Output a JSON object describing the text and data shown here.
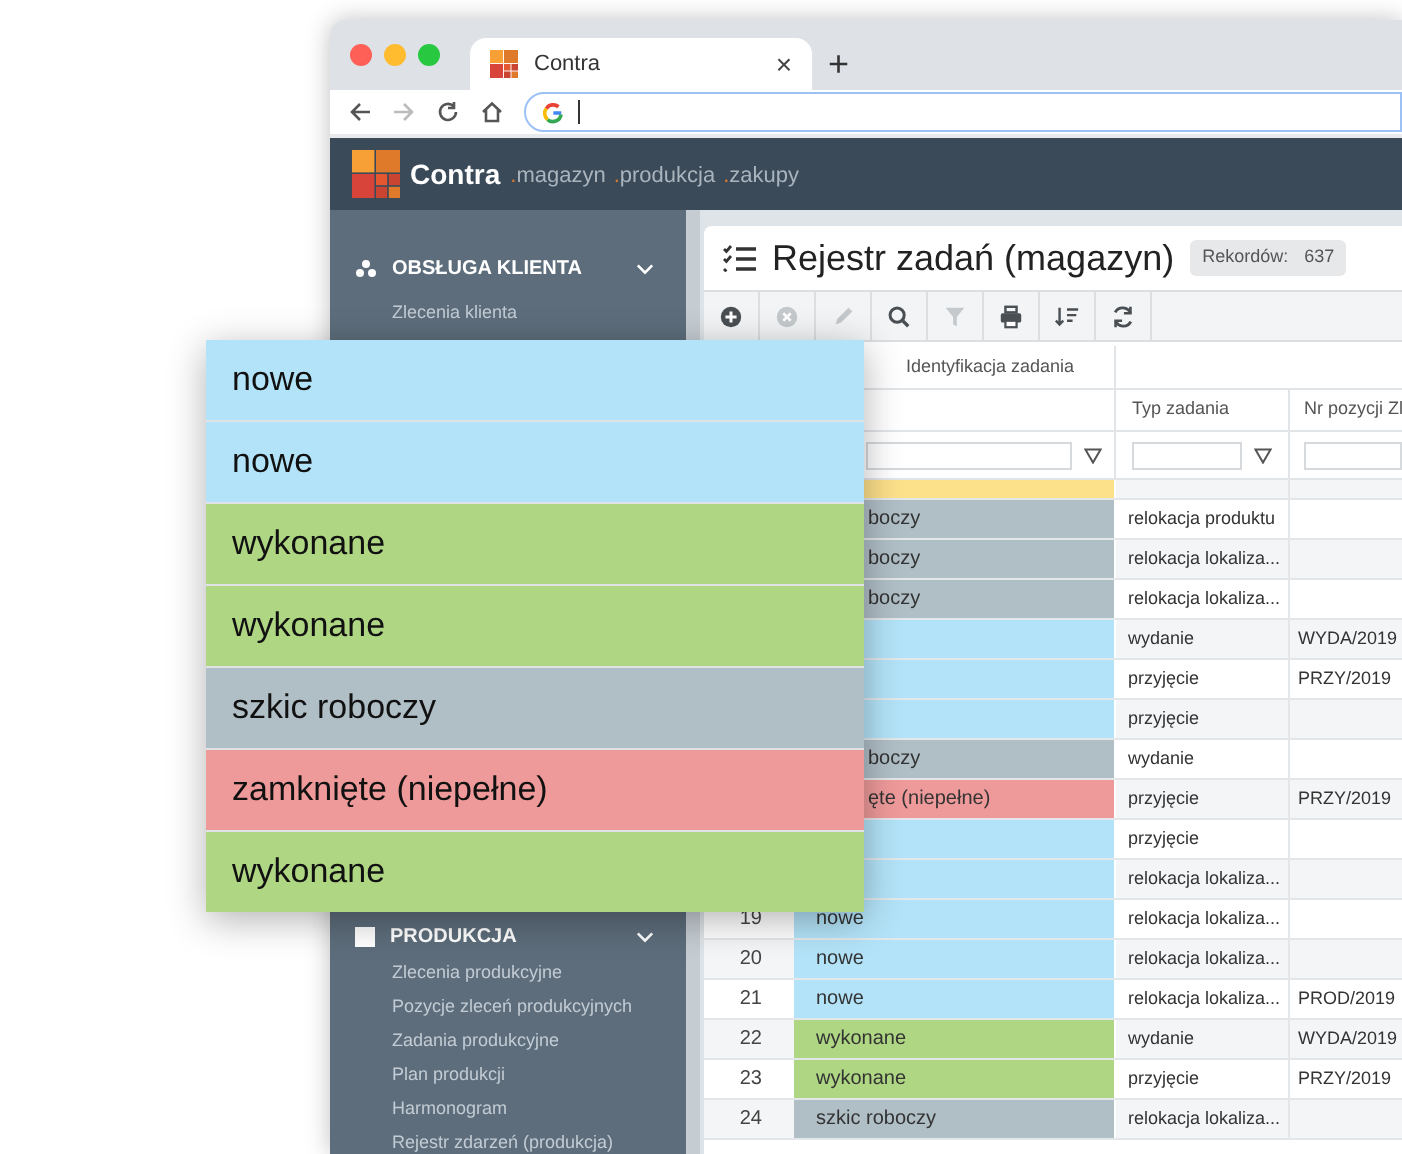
{
  "browser": {
    "tab_title": "Contra",
    "tab_close": "×",
    "new_tab": "+"
  },
  "app_header": {
    "brand": "Contra",
    "modules": [
      ".magazyn",
      ".produkcja",
      ".zakupy"
    ]
  },
  "sidebar": {
    "sections": [
      {
        "kind": "customers",
        "title": "OBSŁUGA KLIENTA",
        "expanded": true,
        "items": [
          "Zlecenia klienta"
        ]
      },
      {
        "kind": "production",
        "title": "PRODUKCJA",
        "expanded": true,
        "items": [
          "Zlecenia produkcyjne",
          "Pozycje zleceń produkcyjnych",
          "Zadania produkcyjne",
          "Plan produkcji",
          "Harmonogram",
          "Rejestr zdarzeń (produkcja)"
        ]
      }
    ]
  },
  "page": {
    "title": "Rejestr zadań (magazyn)",
    "records_label": "Rekordów:",
    "records_count": "637"
  },
  "toolbar": [
    {
      "kind": "add",
      "disabled": false
    },
    {
      "kind": "cancel",
      "disabled": true
    },
    {
      "kind": "edit",
      "disabled": true
    },
    {
      "kind": "search",
      "disabled": false
    },
    {
      "kind": "filter",
      "disabled": true
    },
    {
      "kind": "print",
      "disabled": false
    },
    {
      "kind": "sort",
      "disabled": false
    },
    {
      "kind": "refresh",
      "disabled": false
    }
  ],
  "table": {
    "group_headers": [
      "Identyfikacja zadania"
    ],
    "columns": [
      "Typ zadania",
      "Nr pozycji Zl"
    ],
    "rows": [
      {
        "color": "#fde08a"
      },
      {
        "color": "#b0bec6",
        "status": "boczy",
        "type": "relokacja produktu"
      },
      {
        "color": "#b0bec6",
        "status": "boczy",
        "type": "relokacja lokaliza..."
      },
      {
        "color": "#b0bec6",
        "status": "boczy",
        "type": "relokacja lokaliza..."
      },
      {
        "color": "#b3e3f8",
        "type": "wydanie",
        "order": "WYDA/2019"
      },
      {
        "color": "#b3e3f8",
        "type": "przyjęcie",
        "order": "PRZY/2019"
      },
      {
        "color": "#b3e3f8",
        "type": "przyjęcie"
      },
      {
        "color": "#b0bec6",
        "status": "boczy",
        "type": "wydanie"
      },
      {
        "color": "#ef9a9a",
        "status": "ęte (niepełne)",
        "type": "przyjęcie",
        "order": "PRZY/2019"
      },
      {
        "color": "#b3e3f8",
        "type": "przyjęcie"
      },
      {
        "color": "#b3e3f8",
        "type": "relokacja lokaliza..."
      },
      {
        "number": "19",
        "color": "#b3e3f8",
        "status": "nowe",
        "type": "relokacja lokaliza..."
      },
      {
        "number": "20",
        "color": "#b3e3f8",
        "status": "nowe",
        "type": "relokacja lokaliza..."
      },
      {
        "number": "21",
        "color": "#b3e3f8",
        "status": "nowe",
        "type": "relokacja lokaliza...",
        "order": "PROD/2019"
      },
      {
        "number": "22",
        "color": "#afd683",
        "status": "wykonane",
        "type": "wydanie",
        "order": "WYDA/2019"
      },
      {
        "number": "23",
        "color": "#afd683",
        "status": "wykonane",
        "type": "przyjęcie",
        "order": "PRZY/2019"
      },
      {
        "number": "24",
        "color": "#b0bec6",
        "status": "szkic roboczy",
        "type": "relokacja lokaliza..."
      }
    ]
  },
  "callout": [
    {
      "status": "nowe",
      "color": "#b3e3f8"
    },
    {
      "status": "nowe",
      "color": "#b3e3f8"
    },
    {
      "status": "wykonane",
      "color": "#afd683"
    },
    {
      "status": "wykonane",
      "color": "#afd683"
    },
    {
      "status": "szkic roboczy",
      "color": "#b0bec6"
    },
    {
      "status": "zamknięte (niepełne)",
      "color": "#ef9a9a"
    },
    {
      "status": "wykonane",
      "color": "#afd683"
    }
  ]
}
